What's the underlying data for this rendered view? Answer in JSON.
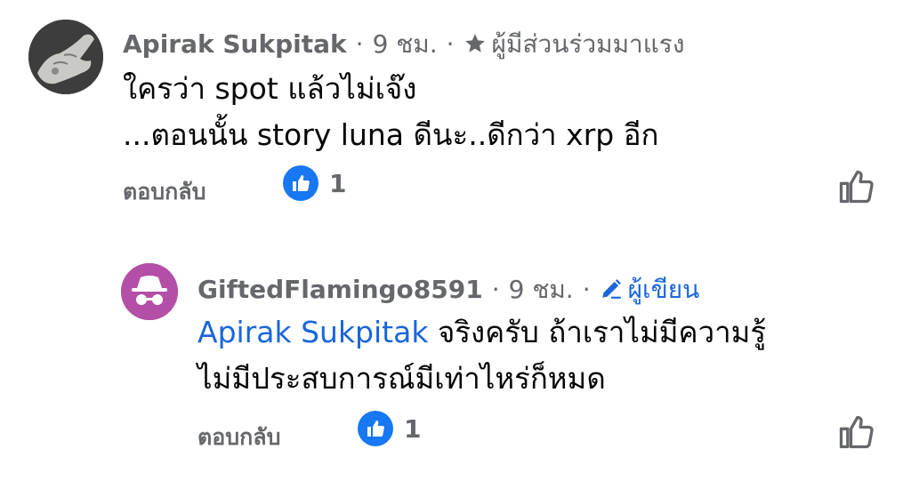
{
  "comments": [
    {
      "author": "Apirak Sukpitak",
      "time": "9 ชม.",
      "separator": "·",
      "badge": "ผู้มีส่วนร่วมมาแรง",
      "badge_icon": "star-icon",
      "lines": [
        "ใครว่า spot แล้วไม่เจ๊ง",
        "...ตอนนั้น story luna ดีนะ..ดีกว่า xrp อีก"
      ],
      "reply_label": "ตอบกลับ",
      "reaction_count": "1"
    },
    {
      "author": "GiftedFlamingo8591",
      "time": "9 ชม.",
      "separator": "·",
      "badge": "ผู้เขียน",
      "badge_icon": "pencil-icon",
      "mention": "Apirak Sukpitak",
      "line1_rest": " จริงครับ ถ้าเราไม่มีความรู้",
      "line2": "ไม่มีประสบการณ์มีเท่าไหร่ก็หมด",
      "reply_label": "ตอบกลับ",
      "reaction_count": "1",
      "avatar_icon": "incognito-icon"
    }
  ],
  "colors": {
    "link": "#1a66d9",
    "like": "#1877f2",
    "meta": "#65676b",
    "avatar2": "#b34fa6"
  }
}
